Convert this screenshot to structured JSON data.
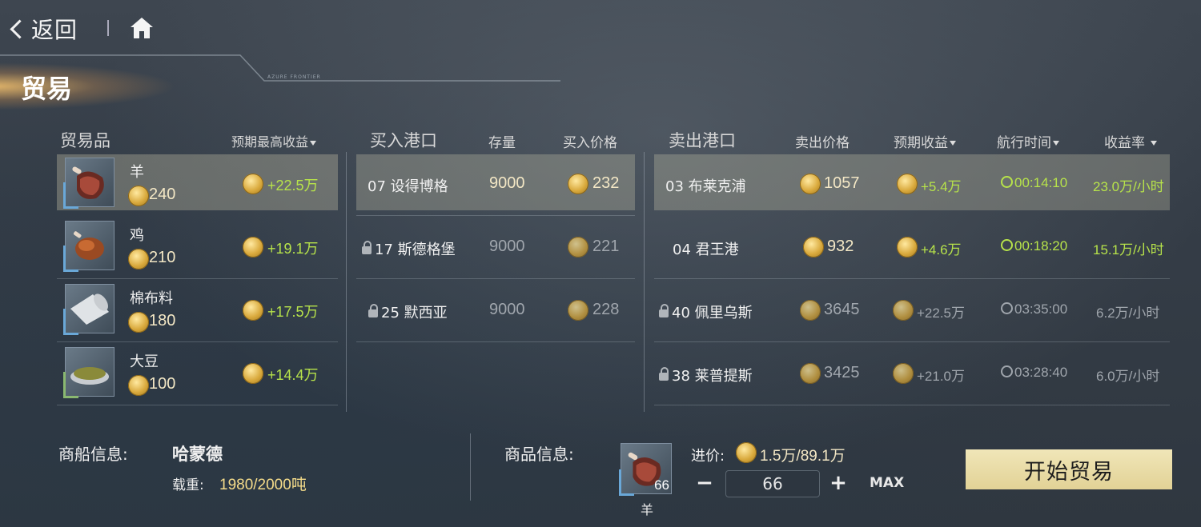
{
  "nav": {
    "back_label": "返回"
  },
  "page": {
    "title": "贸易",
    "subtitle": "AZURE FRONTIER"
  },
  "goods_header": {
    "name": "贸易品",
    "max_profit": "预期最高收益"
  },
  "goods": [
    {
      "name": "羊",
      "price": "240",
      "max_profit": "+22.5万",
      "icon": "meat-icon"
    },
    {
      "name": "鸡",
      "price": "210",
      "max_profit": "+19.1万",
      "icon": "roast-chicken-icon"
    },
    {
      "name": "棉布料",
      "price": "180",
      "max_profit": "+17.5万",
      "icon": "cloth-roll-icon"
    },
    {
      "name": "大豆",
      "price": "100",
      "max_profit": "+14.4万",
      "icon": "soybean-icon"
    }
  ],
  "buy_header": {
    "port": "买入港口",
    "stock": "存量",
    "price": "买入价格"
  },
  "buy_ports": [
    {
      "name": "07 设得博格",
      "stock": "9000",
      "price": "232",
      "locked": false
    },
    {
      "name": "17 斯德格堡",
      "stock": "9000",
      "price": "221",
      "locked": true
    },
    {
      "name": "25 默西亚",
      "stock": "9000",
      "price": "228",
      "locked": true
    }
  ],
  "sell_header": {
    "port": "卖出港口",
    "price": "卖出价格",
    "profit": "预期收益",
    "time": "航行时间",
    "rate": "收益率"
  },
  "sell_ports": [
    {
      "name": "03 布莱克浦",
      "price": "1057",
      "profit": "+5.4万",
      "time": "00:14:10",
      "rate": "23.0万/小时",
      "locked": false
    },
    {
      "name": "04 君王港",
      "price": "932",
      "profit": "+4.6万",
      "time": "00:18:20",
      "rate": "15.1万/小时",
      "locked": false
    },
    {
      "name": "40 佩里乌斯",
      "price": "3645",
      "profit": "+22.5万",
      "time": "03:35:00",
      "rate": "6.2万/小时",
      "locked": true
    },
    {
      "name": "38 莱普提斯",
      "price": "3425",
      "profit": "+21.0万",
      "time": "03:28:40",
      "rate": "6.0万/小时",
      "locked": true
    }
  ],
  "ship": {
    "label": "商船信息:",
    "name": "哈蒙德",
    "load_label": "载重:",
    "load": "1980/2000吨"
  },
  "goods_info": {
    "label": "商品信息:",
    "item_name": "羊",
    "item_count": "66",
    "cost_label": "进价:",
    "cost": "1.5万/89.1万",
    "quantity": "66",
    "max_label": "MAX"
  },
  "actions": {
    "start": "开始贸易"
  },
  "colors": {
    "positive": "#b7e34a",
    "selected_row": "#c8c3aa",
    "start_button": "#e9dca6"
  }
}
